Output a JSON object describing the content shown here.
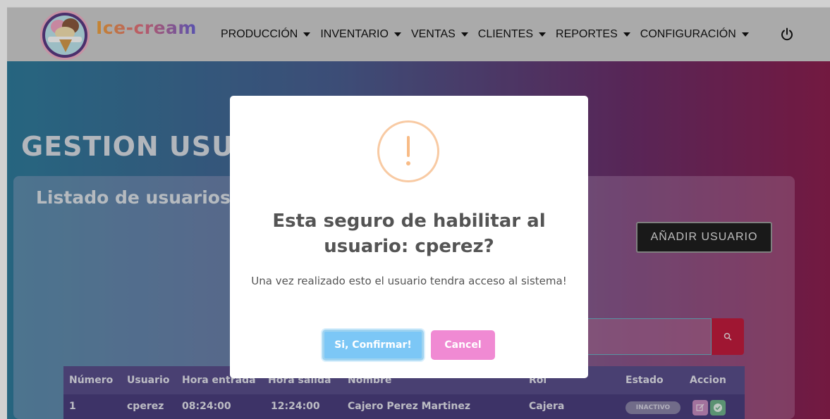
{
  "brand": {
    "name": "Ice-cream"
  },
  "nav": {
    "items": [
      {
        "label": "PRODUCCIÓN"
      },
      {
        "label": "INVENTARIO"
      },
      {
        "label": "VENTAS"
      },
      {
        "label": "CLIENTES"
      },
      {
        "label": "REPORTES"
      },
      {
        "label": "CONFIGURACIÓN"
      }
    ],
    "power_icon": "power-icon"
  },
  "page": {
    "title": "GESTION USUARIOS",
    "card_title": "Listado de usuarios",
    "add_user_label": "AÑADIR USUARIO",
    "search_icon": "search-icon"
  },
  "table": {
    "headers": [
      "Número",
      "Usuario",
      "Hora entrada",
      "Hora salida",
      "Nombre",
      "Rol",
      "Estado",
      "Accion"
    ],
    "rows": [
      {
        "numero": "1",
        "usuario": "cperez",
        "hora_entrada": "08:24:00",
        "hora_salida": "12:24:00",
        "nombre": "Cajero Perez Martinez",
        "rol": "Cajera",
        "estado": "INACTIVO"
      }
    ]
  },
  "modal": {
    "icon": "warning-icon",
    "icon_glyph": "!",
    "title": "Esta seguro de habilitar al usuario: cperez?",
    "text": "Una vez realizado esto el usuario tendra acceso al sistema!",
    "confirm_label": "Si, Confirmar!",
    "cancel_label": "Cancel"
  },
  "colors": {
    "confirm": "#7cc7f6",
    "cancel": "#f08ad3",
    "warning": "#f8bb86",
    "search_button": "#c31c3d"
  }
}
